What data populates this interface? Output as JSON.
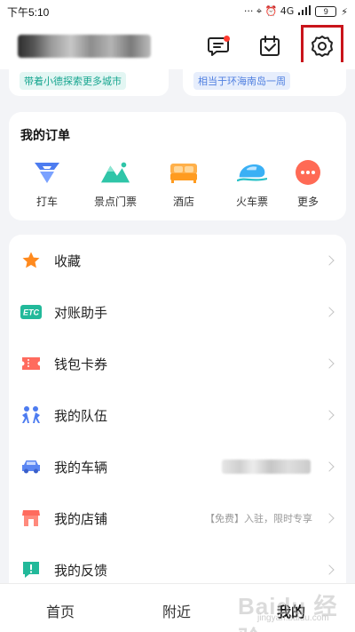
{
  "status_bar": {
    "time": "下午5:10",
    "indicators": "··· ⌖ ⏰ 4G ",
    "battery": "9"
  },
  "header": {
    "icons": [
      "message-icon",
      "task-check-icon",
      "settings-icon"
    ]
  },
  "promo": {
    "left_tag": "带着小德探索更多城市",
    "right_tag": "相当于环海南岛一周"
  },
  "orders": {
    "title": "我的订单",
    "items": [
      {
        "label": "打车",
        "icon": "taxi-icon"
      },
      {
        "label": "景点门票",
        "icon": "scenic-ticket-icon"
      },
      {
        "label": "酒店",
        "icon": "hotel-icon"
      },
      {
        "label": "火车票",
        "icon": "train-ticket-icon"
      },
      {
        "label": "更多",
        "icon": "more-icon"
      }
    ]
  },
  "menu": {
    "items": [
      {
        "label": "收藏",
        "icon": "star-icon",
        "value": ""
      },
      {
        "label": "对账助手",
        "icon": "etc-icon",
        "value": ""
      },
      {
        "label": "钱包卡券",
        "icon": "ticket-icon",
        "value": ""
      },
      {
        "label": "我的队伍",
        "icon": "team-icon",
        "value": ""
      },
      {
        "label": "我的车辆",
        "icon": "car-icon",
        "value": ""
      },
      {
        "label": "我的店铺",
        "icon": "shop-icon",
        "value": "【免费】入驻，限时专享"
      },
      {
        "label": "我的反馈",
        "icon": "feedback-icon",
        "value": ""
      }
    ]
  },
  "tabs": {
    "home": "首页",
    "nearby": "附近",
    "mine": "我的"
  },
  "watermark": {
    "main": "Baidu 经验",
    "sub": "jingyan.baidu.com"
  },
  "colors": {
    "highlight_box": "#c9141b",
    "badge": "#ff3b30",
    "accent_teal": "#16a58f",
    "accent_blue": "#4f7fe0"
  }
}
